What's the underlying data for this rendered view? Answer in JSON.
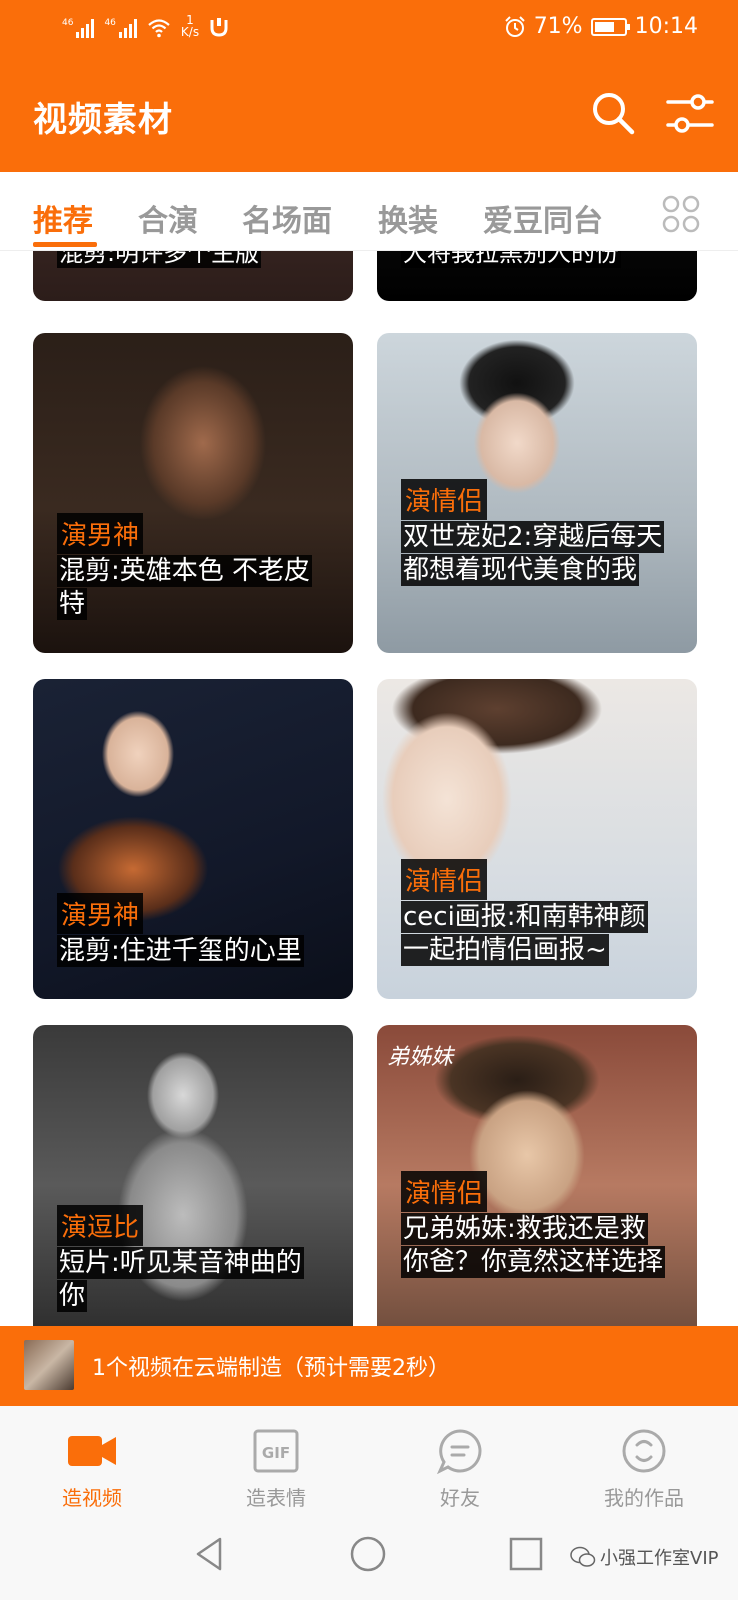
{
  "status_bar": {
    "network_1": "46",
    "network_2": "46",
    "speed_value": "1",
    "speed_unit": "K/s",
    "battery": "71%",
    "battery_level": 0.71,
    "time": "10:14"
  },
  "header": {
    "title": "视频素材",
    "search_icon": "search-icon",
    "filter_icon": "sliders-icon",
    "bg_color": "#fa6e0a"
  },
  "tabs": [
    {
      "label": "推荐",
      "active": true
    },
    {
      "label": "合演",
      "active": false
    },
    {
      "label": "名场面",
      "active": false
    },
    {
      "label": "换装",
      "active": false
    },
    {
      "label": "爱豆同台",
      "active": false
    }
  ],
  "partial_cards": [
    {
      "title": "混剪:明评多个主版"
    },
    {
      "title": "大将莪拉黑别人的份"
    }
  ],
  "cards": [
    {
      "category": "演男神",
      "title": "混剪:英雄本色 不老皮特"
    },
    {
      "category": "演情侣",
      "title": "双世宠妃2:穿越后每天都想着现代美食的我"
    },
    {
      "category": "演男神",
      "title": "混剪:住进千玺的心里"
    },
    {
      "category": "演情侣",
      "title": "ceci画报:和南韩神颜一起拍情侣画报~"
    },
    {
      "category": "演逗比",
      "title": "短片:听见某音神曲的你"
    },
    {
      "category": "演情侣",
      "title": "兄弟姊妹:救我还是救你爸？你竟然这样选择",
      "overlay": "弟姊妹"
    }
  ],
  "toast": {
    "message": "1个视频在云端制造（预计需要2秒）"
  },
  "bottom_nav": [
    {
      "label": "造视频",
      "icon": "video-camera-icon",
      "active": true
    },
    {
      "label": "造表情",
      "icon": "gif-icon",
      "active": false
    },
    {
      "label": "好友",
      "icon": "chat-bubble-icon",
      "active": false
    },
    {
      "label": "我的作品",
      "icon": "smile-circle-icon",
      "active": false
    }
  ],
  "watermark": "小强工作室VIP",
  "colors": {
    "accent": "#fa6e0a",
    "inactive": "#999999"
  }
}
